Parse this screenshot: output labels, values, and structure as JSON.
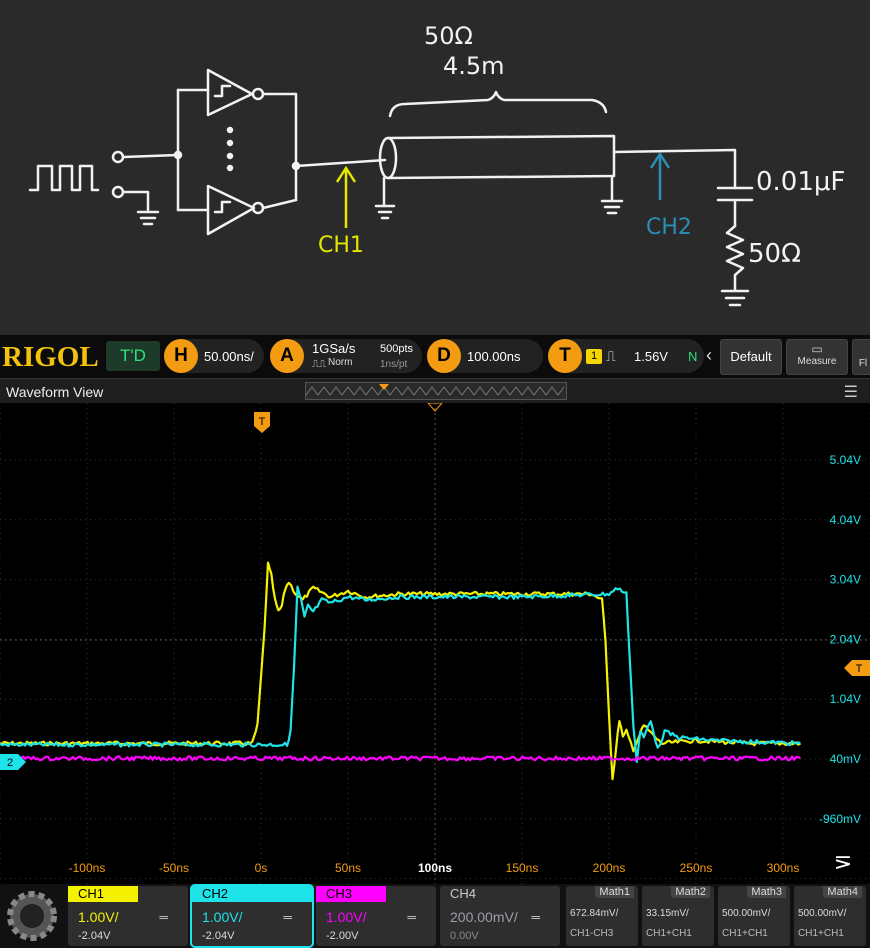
{
  "sketch": {
    "impedance_label": "50Ω",
    "length_label": "4.5m",
    "ch1_label": "CH1",
    "ch2_label": "CH2",
    "cap_label": "0.01μF",
    "res_label": "50Ω"
  },
  "topbar": {
    "brand": "RIGOL",
    "td_label": "T'D",
    "horizontal": {
      "key": "H",
      "value": "50.00ns/"
    },
    "acquire": {
      "key": "A",
      "rate": "1GSa/s",
      "points": "500pts",
      "mode": "Norm",
      "res": "1ns/pt"
    },
    "delay": {
      "key": "D",
      "value": "100.00ns"
    },
    "trigger": {
      "key": "T",
      "source": "1",
      "level": "1.56V",
      "sweep": "N"
    },
    "default_label": "Default",
    "measure_label": "Measure",
    "cut_label": "Fl"
  },
  "waveform_view": {
    "title": "Waveform View",
    "trigger_marker": "T",
    "ch2_marker": "2",
    "y_labels": [
      "5.04V",
      "4.04V",
      "3.04V",
      "2.04V",
      "1.04V",
      "40mV",
      "-960mV"
    ],
    "x_labels": [
      "-100ns",
      "-50ns",
      "0s",
      "50ns",
      "100ns",
      "150ns",
      "200ns",
      "250ns",
      "300ns"
    ]
  },
  "channels": [
    {
      "name": "CH1",
      "scale": "1.00V/",
      "offset": "-2.04V",
      "color": "#f4f200"
    },
    {
      "name": "CH2",
      "scale": "1.00V/",
      "offset": "-2.04V",
      "color": "#1ee3e8"
    },
    {
      "name": "CH3",
      "scale": "1.00V/",
      "offset": "-2.00V",
      "color": "#ff00ff"
    },
    {
      "name": "CH4",
      "scale": "200.00mV/",
      "offset": "0.00V",
      "color": "#9aa0a6"
    }
  ],
  "maths": [
    {
      "name": "Math1",
      "scale": "672.84mV/",
      "expr": "CH1-CH3"
    },
    {
      "name": "Math2",
      "scale": "33.15mV/",
      "expr": "CH1+CH1"
    },
    {
      "name": "Math3",
      "scale": "500.00mV/",
      "expr": "CH1+CH1"
    },
    {
      "name": "Math4",
      "scale": "500.00mV/",
      "expr": "CH1+CH1"
    }
  ],
  "chart_data": {
    "type": "line",
    "title": "",
    "xlabel": "",
    "ylabel": "",
    "xlim": [
      -150,
      310
    ],
    "ylim": [
      -1.5,
      5.5
    ],
    "grid": true,
    "series": [
      {
        "name": "CH1",
        "color": "#f4f200",
        "x": [
          -150,
          -5,
          -2,
          2,
          4,
          6,
          8,
          10,
          12,
          14,
          16,
          20,
          24,
          30,
          40,
          50,
          60,
          80,
          100,
          150,
          190,
          196,
          198,
          200,
          202,
          204,
          206,
          208,
          210,
          214,
          220,
          230,
          250,
          280,
          310
        ],
        "y": [
          0.3,
          0.3,
          0.6,
          2.2,
          3.3,
          3.1,
          2.7,
          2.5,
          2.6,
          2.9,
          3.0,
          2.8,
          2.7,
          2.9,
          2.75,
          2.85,
          2.75,
          2.8,
          2.8,
          2.8,
          2.8,
          2.7,
          2.0,
          0.8,
          -0.3,
          0.2,
          0.7,
          0.4,
          0.5,
          0.2,
          0.6,
          0.3,
          0.35,
          0.3,
          0.3
        ]
      },
      {
        "name": "CH2",
        "color": "#1ee3e8",
        "x": [
          -150,
          15,
          17,
          19,
          21,
          23,
          25,
          27,
          30,
          35,
          40,
          50,
          60,
          80,
          100,
          150,
          200,
          205,
          210,
          212,
          214,
          216,
          218,
          220,
          224,
          228,
          232,
          240,
          260,
          310
        ],
        "y": [
          0.28,
          0.28,
          0.5,
          1.6,
          2.9,
          2.7,
          2.4,
          2.6,
          2.5,
          2.7,
          2.65,
          2.75,
          2.7,
          2.75,
          2.75,
          2.75,
          2.8,
          2.9,
          2.8,
          1.7,
          0.6,
          0.0,
          0.5,
          0.4,
          0.7,
          0.2,
          0.5,
          0.4,
          0.35,
          0.3
        ]
      },
      {
        "name": "CH3",
        "color": "#ff00ff",
        "x": [
          -150,
          310
        ],
        "y": [
          0.05,
          0.05
        ]
      }
    ]
  }
}
